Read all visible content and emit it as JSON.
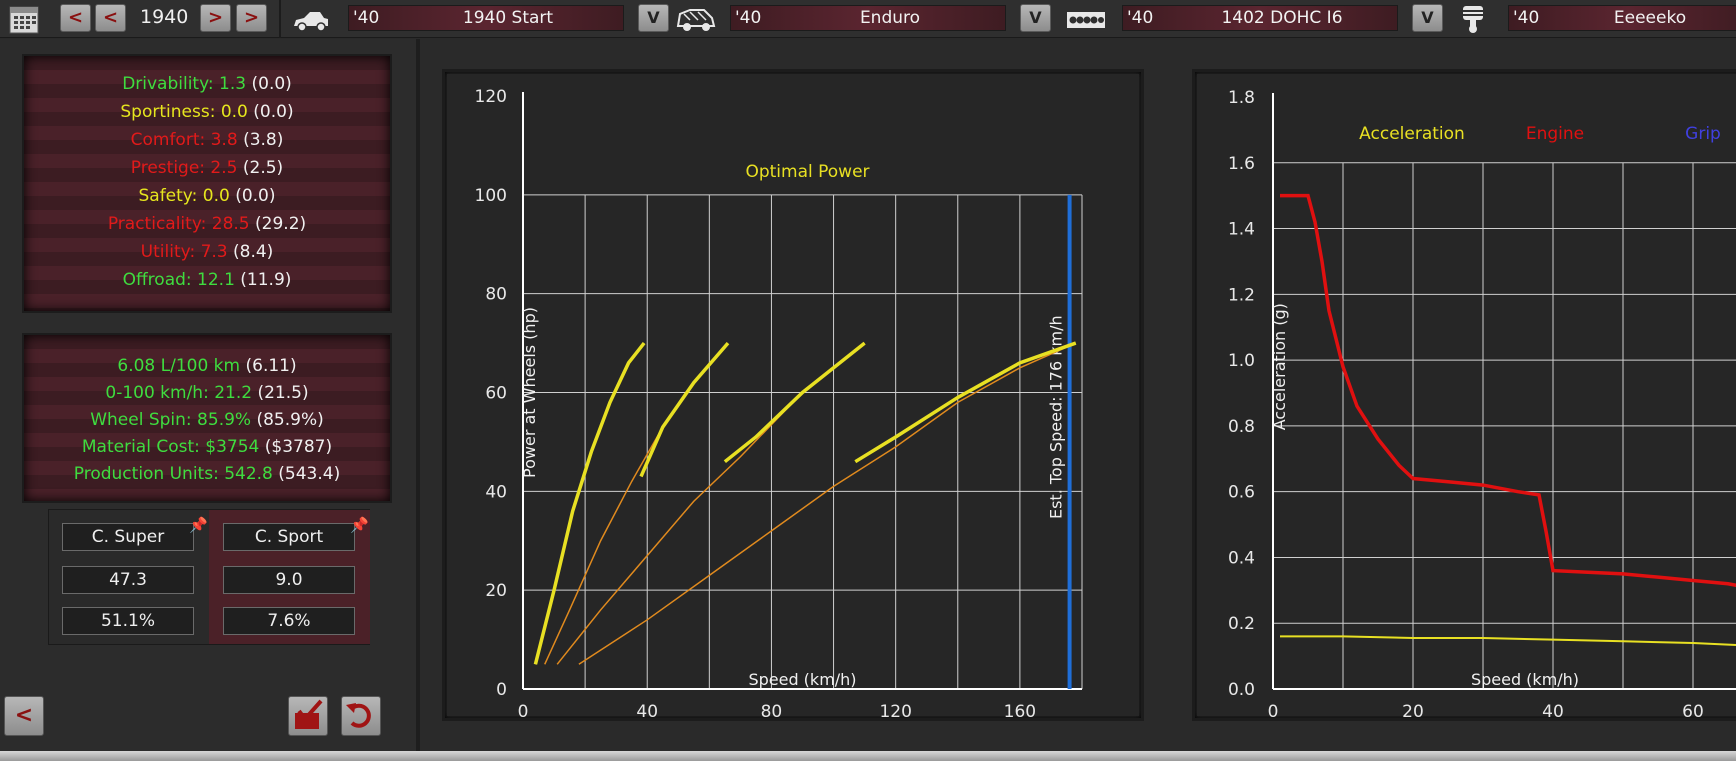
{
  "toolbar": {
    "year_prev_label": "<",
    "year_prev2_label": "<",
    "year": "1940",
    "year_next_label": ">",
    "year_next2_label": ">",
    "model": {
      "year": "'40",
      "name": "1940 Start"
    },
    "trim": {
      "year": "'40",
      "name": "Enduro"
    },
    "engine": {
      "year": "'40",
      "name": "1402 DOHC I6"
    },
    "variant": {
      "year": "'40",
      "name": "Eeeeeko"
    },
    "dropdown_label": "V"
  },
  "stats": {
    "ratings": [
      {
        "label": "Drivability: 1.3",
        "base": "(0.0)",
        "color": "green"
      },
      {
        "label": "Sportiness: 0.0",
        "base": "(0.0)",
        "color": "yellow"
      },
      {
        "label": "Comfort: 3.8",
        "base": "(3.8)",
        "color": "red"
      },
      {
        "label": "Prestige: 2.5",
        "base": "(2.5)",
        "color": "red"
      },
      {
        "label": "Safety: 0.0",
        "base": "(0.0)",
        "color": "yellow"
      },
      {
        "label": "Practicality: 28.5",
        "base": "(29.2)",
        "color": "red"
      },
      {
        "label": "Utility: 7.3",
        "base": "(8.4)",
        "color": "red"
      },
      {
        "label": "Offroad: 12.1",
        "base": "(11.9)",
        "color": "green"
      }
    ],
    "performance": [
      {
        "label": "6.08 L/100 km",
        "base": "(6.11)",
        "color": "green"
      },
      {
        "label": "0-100 km/h: 21.2",
        "base": "(21.5)",
        "color": "green"
      },
      {
        "label": "Wheel Spin: 85.9%",
        "base": "(85.9%)",
        "color": "green"
      },
      {
        "label": "Material Cost: $3754",
        "base": "($3787)",
        "color": "green"
      },
      {
        "label": "Production Units: 542.8",
        "base": "(543.4)",
        "color": "green"
      }
    ]
  },
  "market": {
    "columns": [
      {
        "name": "C. Super",
        "score": "47.3",
        "share": "51.1%"
      },
      {
        "name": "C. Sport",
        "score": "9.0",
        "share": "7.6%"
      }
    ]
  },
  "nav": {
    "back_label": "<"
  },
  "colors": {
    "gear_curve": "#e8e023",
    "gear_curve_dim": "#e08a1e",
    "top_speed_line": "#1f6ed8",
    "engine_curve": "#e01010",
    "grip_curve": "#4040e0",
    "accel_curve": "#e8e023"
  },
  "chart_data": [
    {
      "type": "line",
      "title": "Optimal Power",
      "xlabel": "Speed (km/h)",
      "ylabel": "Power at Wheels (hp)",
      "xlim": [
        0,
        180
      ],
      "ylim": [
        0,
        120
      ],
      "xticks": [
        "0",
        "40",
        "80",
        "120",
        "160"
      ],
      "yticks": [
        "0",
        "20",
        "40",
        "60",
        "80",
        "100",
        "120"
      ],
      "grid": true,
      "annotation": "Est. Top Speed: 176 km/h",
      "top_speed": 176,
      "series": [
        {
          "x": [
            4,
            10,
            16,
            22,
            28,
            34,
            39
          ],
          "y": [
            5,
            20,
            36,
            48,
            58,
            66,
            70
          ]
        },
        {
          "x": [
            7,
            15,
            25,
            35,
            45,
            55,
            66
          ],
          "y": [
            5,
            16,
            30,
            42,
            53,
            62,
            70
          ]
        },
        {
          "x": [
            11,
            25,
            40,
            55,
            70,
            90,
            110
          ],
          "y": [
            5,
            16,
            27,
            38,
            47,
            60,
            70
          ]
        },
        {
          "x": [
            18,
            40,
            60,
            80,
            100,
            120,
            140,
            160,
            178
          ],
          "y": [
            5,
            14,
            23,
            32,
            41,
            49,
            58,
            65,
            70
          ]
        }
      ],
      "bright_segments": [
        {
          "x": [
            4,
            10,
            16,
            22,
            28,
            34,
            39
          ],
          "y": [
            5,
            20,
            36,
            48,
            58,
            66,
            70
          ]
        },
        {
          "x": [
            38,
            45,
            55,
            66
          ],
          "y": [
            43,
            53,
            62,
            70
          ]
        },
        {
          "x": [
            65,
            75,
            90,
            110
          ],
          "y": [
            46,
            51,
            60,
            70
          ]
        },
        {
          "x": [
            107,
            120,
            140,
            160,
            178
          ],
          "y": [
            46,
            51,
            59,
            66,
            70
          ]
        }
      ]
    },
    {
      "type": "line",
      "xlabel": "Speed (km/h)",
      "ylabel": "Acceleration (g)",
      "xlim": [
        0,
        70
      ],
      "ylim": [
        0,
        1.8
      ],
      "xticks": [
        "0",
        "20",
        "40",
        "60"
      ],
      "yticks": [
        "0.0",
        "0.2",
        "0.4",
        "0.6",
        "0.8",
        "1.0",
        "1.2",
        "1.4",
        "1.6",
        "1.8"
      ],
      "grid": true,
      "legend": [
        "Acceleration",
        "Engine",
        "Grip"
      ],
      "series": [
        {
          "name": "Engine",
          "x": [
            1,
            5,
            6,
            7,
            8,
            10,
            12,
            15,
            18,
            20,
            25,
            30,
            35,
            38,
            39,
            40,
            45,
            50,
            55,
            60,
            65,
            70
          ],
          "y": [
            1.5,
            1.5,
            1.42,
            1.3,
            1.15,
            0.98,
            0.86,
            0.76,
            0.68,
            0.64,
            0.63,
            0.62,
            0.6,
            0.59,
            0.48,
            0.36,
            0.355,
            0.35,
            0.34,
            0.33,
            0.32,
            0.3
          ]
        },
        {
          "name": "Acceleration",
          "x": [
            1,
            10,
            20,
            30,
            40,
            50,
            60,
            70
          ],
          "y": [
            0.16,
            0.16,
            0.155,
            0.155,
            0.15,
            0.145,
            0.14,
            0.13
          ]
        }
      ]
    }
  ]
}
